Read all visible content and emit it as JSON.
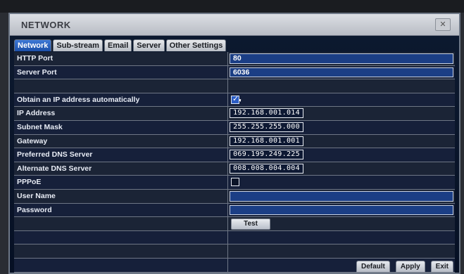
{
  "window": {
    "title": "NETWORK"
  },
  "tabs": [
    "Network",
    "Sub-stream",
    "Email",
    "Server",
    "Other Settings"
  ],
  "rows": [
    {
      "label": "HTTP Port",
      "type": "text",
      "value": "80"
    },
    {
      "label": "Server Port",
      "type": "text",
      "value": "6036"
    },
    {
      "label": "",
      "type": "blank",
      "value": ""
    },
    {
      "label": "Obtain an IP address automatically",
      "type": "checkbox",
      "checked": true
    },
    {
      "label": "IP Address",
      "type": "ip",
      "value": "192.168.001.014"
    },
    {
      "label": "Subnet Mask",
      "type": "ip",
      "value": "255.255.255.000"
    },
    {
      "label": "Gateway",
      "type": "ip",
      "value": "192.168.001.001"
    },
    {
      "label": "Preferred DNS Server",
      "type": "ip",
      "value": "069.199.249.225"
    },
    {
      "label": "Alternate DNS Server",
      "type": "ip",
      "value": "008.008.004.004"
    },
    {
      "label": "PPPoE",
      "type": "checkbox",
      "checked": false
    },
    {
      "label": "User Name",
      "type": "text",
      "value": ""
    },
    {
      "label": "Password",
      "type": "text",
      "value": ""
    },
    {
      "label": "",
      "type": "button",
      "value": "Test"
    },
    {
      "label": "",
      "type": "blank",
      "value": ""
    },
    {
      "label": "",
      "type": "blank",
      "value": ""
    },
    {
      "label": "",
      "type": "blank",
      "value": ""
    }
  ],
  "buttons": {
    "default": "Default",
    "apply": "Apply",
    "exit": "Exit"
  }
}
